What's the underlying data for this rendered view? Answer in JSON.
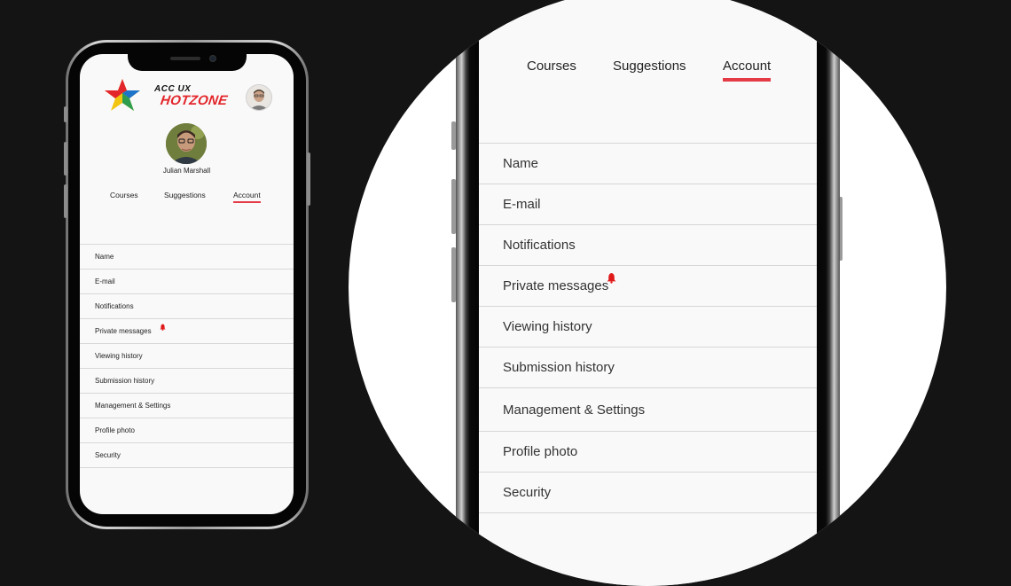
{
  "brand": {
    "top_text": "ACC UX",
    "main_text": "HOTZONE",
    "accent_color": "#e3262b"
  },
  "profile": {
    "name": "Julian Marshall"
  },
  "tabs": [
    {
      "label": "Courses",
      "active": false
    },
    {
      "label": "Suggestions",
      "active": false
    },
    {
      "label": "Account",
      "active": true
    }
  ],
  "menu": [
    {
      "label": "Name"
    },
    {
      "label": "E-mail"
    },
    {
      "label": "Notifications"
    },
    {
      "label": "Private messages",
      "badge_icon": "bell-icon"
    },
    {
      "label": "Viewing history"
    },
    {
      "label": "Submission history"
    },
    {
      "label": "Management & Settings"
    },
    {
      "label": "Profile photo"
    },
    {
      "label": "Security"
    }
  ],
  "colors": {
    "active_tab_underline": "#e43b47",
    "notification_bell": "#e01919",
    "background": "#141414"
  }
}
